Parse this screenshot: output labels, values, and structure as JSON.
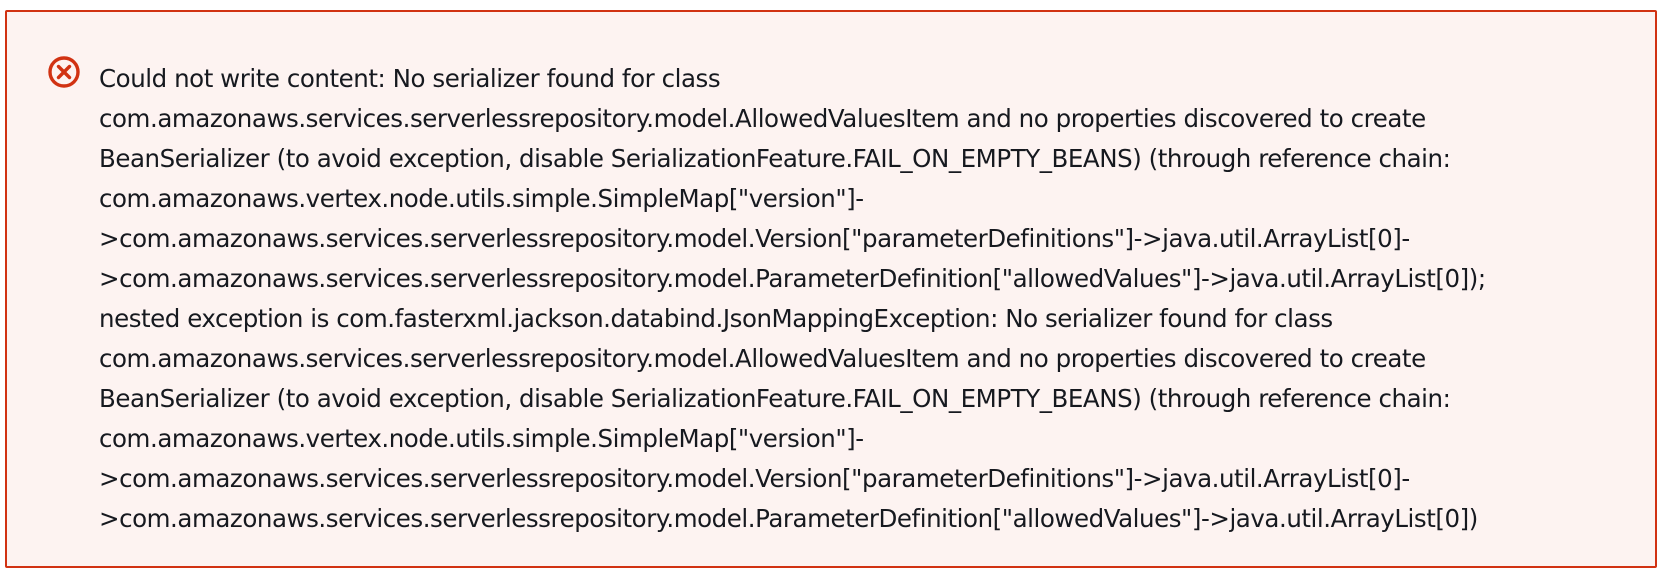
{
  "alert": {
    "type": "error",
    "icon": "error-circle-x-icon",
    "color": "#d13212",
    "background": "#fdf3f1",
    "lines": [
      "Could not write content: No serializer found for class",
      "com.amazonaws.services.serverlessrepository.model.AllowedValuesItem and no properties discovered to create",
      "BeanSerializer (to avoid exception, disable SerializationFeature.FAIL_ON_EMPTY_BEANS) (through reference chain:",
      "com.amazonaws.vertex.node.utils.simple.SimpleMap[\"version\"]-",
      ">com.amazonaws.services.serverlessrepository.model.Version[\"parameterDefinitions\"]->java.util.ArrayList[0]-",
      ">com.amazonaws.services.serverlessrepository.model.ParameterDefinition[\"allowedValues\"]->java.util.ArrayList[0]);",
      "nested exception is com.fasterxml.jackson.databind.JsonMappingException: No serializer found for class",
      "com.amazonaws.services.serverlessrepository.model.AllowedValuesItem and no properties discovered to create",
      "BeanSerializer (to avoid exception, disable SerializationFeature.FAIL_ON_EMPTY_BEANS) (through reference chain:",
      "com.amazonaws.vertex.node.utils.simple.SimpleMap[\"version\"]-",
      ">com.amazonaws.services.serverlessrepository.model.Version[\"parameterDefinitions\"]->java.util.ArrayList[0]-",
      ">com.amazonaws.services.serverlessrepository.model.ParameterDefinition[\"allowedValues\"]->java.util.ArrayList[0])"
    ]
  }
}
